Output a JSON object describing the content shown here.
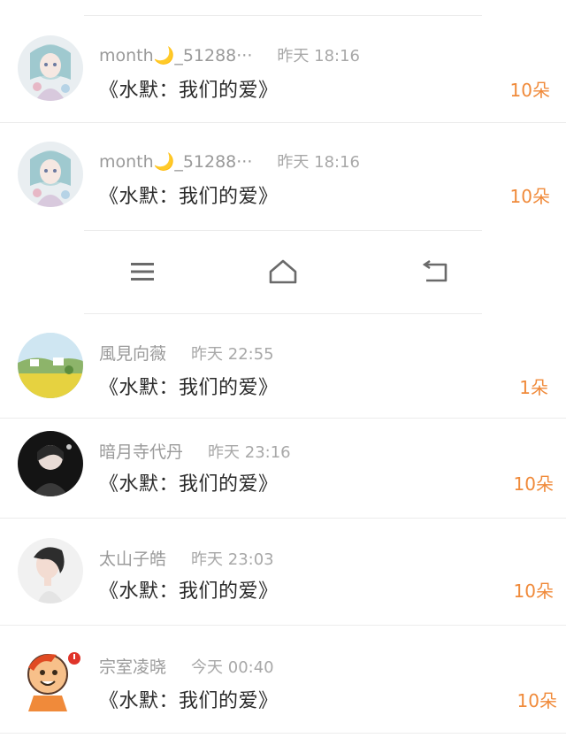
{
  "rows": [
    {
      "username": "month🌙_51288···",
      "time": "昨天 18:16",
      "title": "《水默：我们的爱》",
      "count": "10朵",
      "avatar": "anime-avatar"
    },
    {
      "username": "month🌙_51288···",
      "time": "昨天 18:16",
      "title": "《水默：我们的爱》",
      "count": "10朵",
      "avatar": "anime-avatar"
    },
    {
      "username": "風見向薇",
      "time": "昨天 22:55",
      "title": "《水默：我们的爱》",
      "count": "1朵",
      "avatar": "landscape-avatar"
    },
    {
      "username": "暗月寺代丹",
      "time": "昨天 23:16",
      "title": "《水默：我们的爱》",
      "count": "10朵",
      "avatar": "dark-portrait-avatar"
    },
    {
      "username": "太山子皓",
      "time": "昨天 23:03",
      "title": "《水默：我们的爱》",
      "count": "10朵",
      "avatar": "portrait-avatar"
    },
    {
      "username": "宗室凌晓",
      "time": "今天 00:40",
      "title": "《水默：我们的爱》",
      "count": "10朵",
      "avatar": "cartoon-avatar"
    }
  ],
  "navbar": {
    "icons": [
      "menu-icon",
      "home-icon",
      "back-icon"
    ]
  },
  "colors": {
    "accent": "#f08a3a",
    "text": "#2a2a2a",
    "muted": "#9a9a9a",
    "divider": "#ececec"
  }
}
